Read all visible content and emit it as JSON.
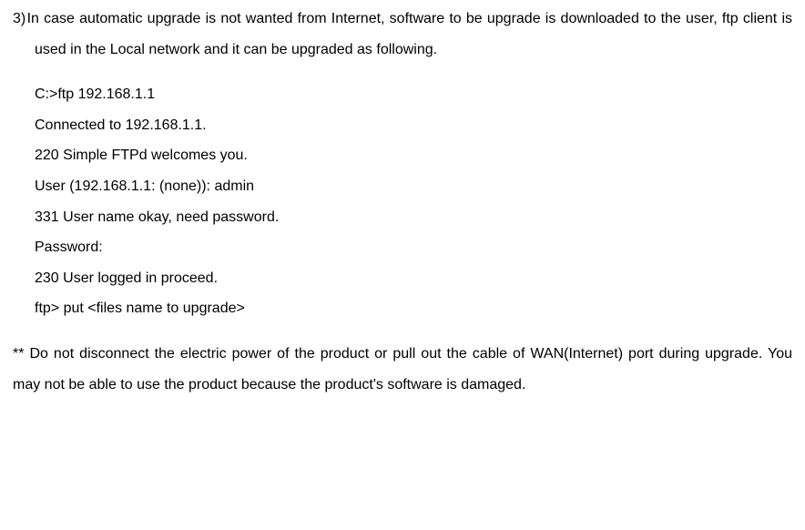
{
  "item3": {
    "number": "3)",
    "text": "In case automatic upgrade is not wanted from Internet, software to be upgrade is downloaded to the user, ftp client is used in the Local network and it can be upgraded as following."
  },
  "terminal": {
    "l1": "C:>ftp 192.168.1.1",
    "l2": "Connected to 192.168.1.1.",
    "l3": "220 Simple FTPd welcomes you.",
    "l4": "User (192.168.1.1: (none)): admin",
    "l5": "331 User name okay, need password.",
    "l6": "Password:",
    "l7": "230 User logged in proceed.",
    "l8": "ftp> put <files name to upgrade>"
  },
  "footer": {
    "text": "**  Do not disconnect the electric power of the product or pull out the cable of WAN(Internet) port during upgrade.  You may not be able to use the product because the product's software is damaged."
  }
}
